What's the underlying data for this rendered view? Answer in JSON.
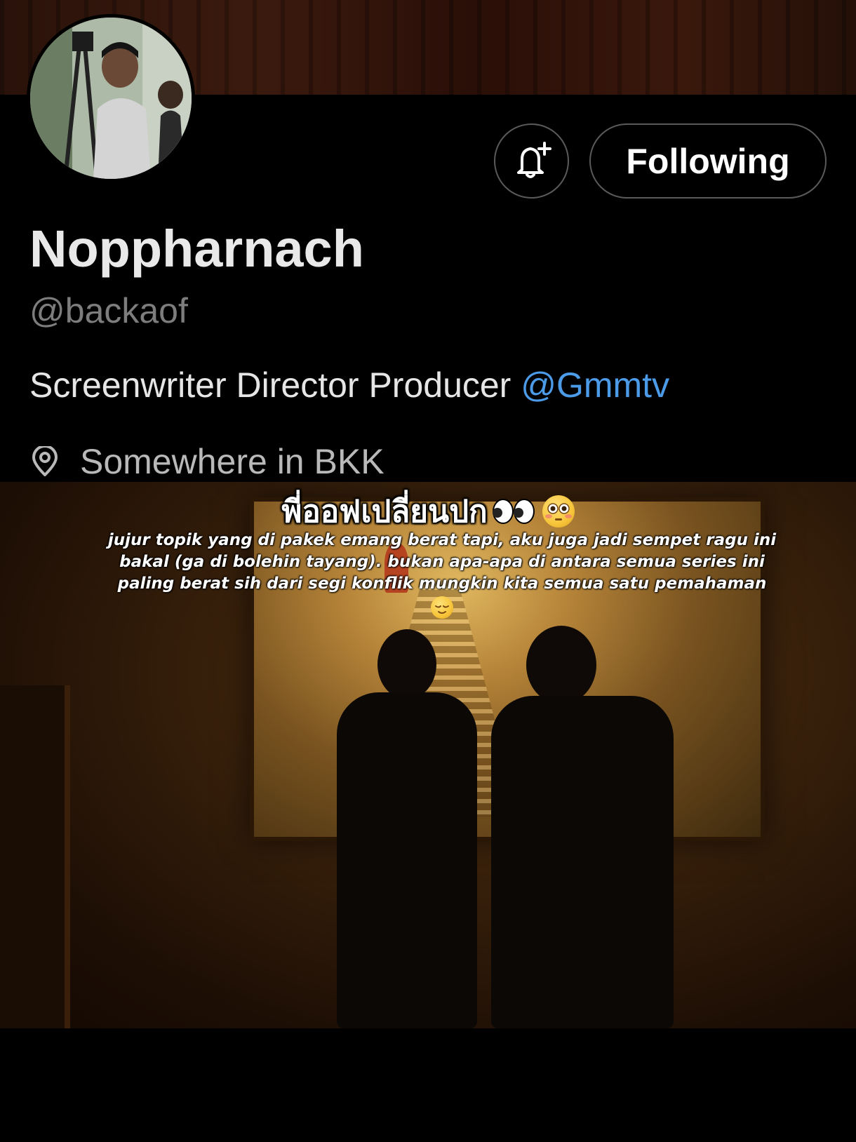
{
  "profile": {
    "display_name": "Noppharnach",
    "handle": "@backaof",
    "bio_text": "Screenwriter Director Producer ",
    "bio_mention": "@Gmmtv",
    "location": "Somewhere in BKK",
    "following_label": "Following"
  },
  "icons": {
    "bell": "bell-plus-icon",
    "location": "location-pin-icon",
    "emoji_flushed": "flushed-face-emoji",
    "emoji_relieved": "relieved-face-emoji"
  },
  "overlay": {
    "thai_caption": "พี่ออฟเปลี่ยนปก",
    "body_caption": "jujur topik yang di pakek emang berat tapi, aku juga jadi sempet ragu ini bakal (ga di bolehin tayang). bukan apa-apa di antara semua series ini paling berat sih dari segi konflik mungkin kita semua satu pemahaman"
  },
  "colors": {
    "mention": "#4c9be8",
    "handle": "#7d7d7d",
    "background": "#000000"
  }
}
